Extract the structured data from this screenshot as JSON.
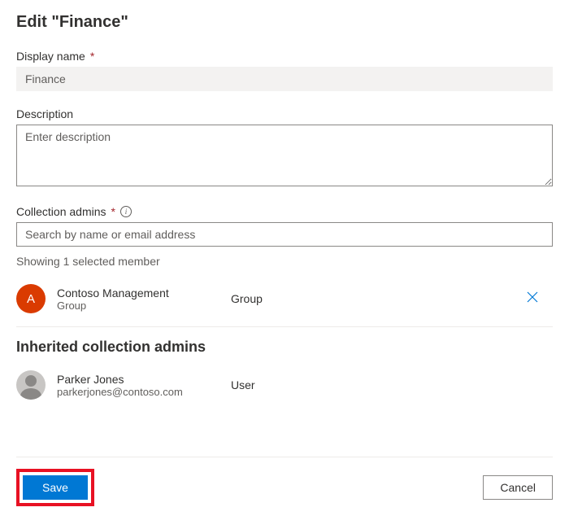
{
  "title": "Edit \"Finance\"",
  "fields": {
    "displayName": {
      "label": "Display name",
      "value": "Finance"
    },
    "description": {
      "label": "Description",
      "placeholder": "Enter description",
      "value": ""
    },
    "collectionAdmins": {
      "label": "Collection admins",
      "placeholder": "Search by name or email address",
      "selectedCountText": "Showing 1 selected member"
    }
  },
  "members": [
    {
      "name": "Contoso Management",
      "sub": "Group",
      "type": "Group",
      "avatarInitial": "A",
      "avatarColor": "#da3b01"
    }
  ],
  "inherited": {
    "heading": "Inherited collection admins",
    "members": [
      {
        "name": "Parker Jones",
        "sub": "parkerjones@contoso.com",
        "type": "User"
      }
    ]
  },
  "buttons": {
    "save": "Save",
    "cancel": "Cancel"
  }
}
